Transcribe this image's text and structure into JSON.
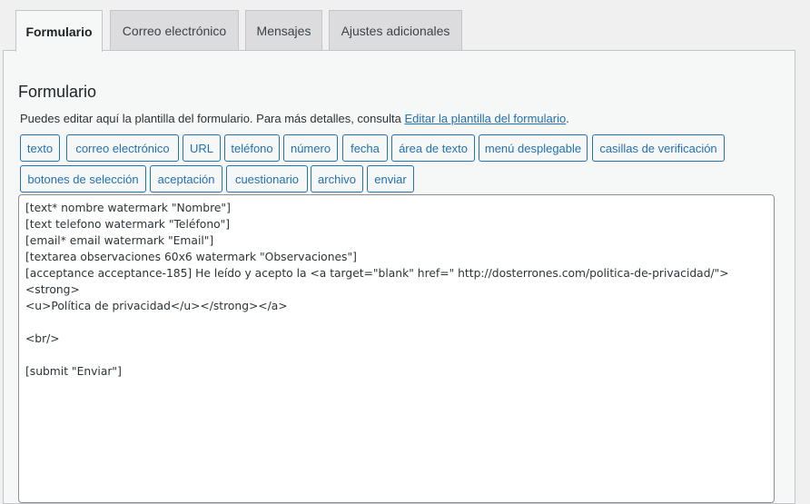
{
  "tabs": [
    {
      "label": "Formulario",
      "active": true
    },
    {
      "label": "Correo electrónico",
      "active": false
    },
    {
      "label": "Mensajes",
      "active": false
    },
    {
      "label": "Ajustes adicionales",
      "active": false
    }
  ],
  "panel": {
    "title": "Formulario",
    "description_prefix": "Puedes editar aquí la plantilla del formulario. Para más detalles, consulta ",
    "description_link": "Editar la plantilla del formulario",
    "description_suffix": "."
  },
  "tag_buttons": [
    "texto",
    "correo electrónico",
    "URL",
    "teléfono",
    "número",
    "fecha",
    "área de texto",
    "menú desplegable",
    "casillas de verificación",
    "botones de selección",
    "aceptación",
    "cuestionario",
    "archivo",
    "enviar"
  ],
  "editor": {
    "content": "[text* nombre watermark \"Nombre\"]\n[text telefono watermark \"Teléfono\"]\n[email* email watermark \"Email\"]\n[textarea observaciones 60x6 watermark \"Observaciones\"]\n[acceptance acceptance-185] He leído y acepto la <a target=\"blank\" href=\" http://dosterrones.com/politica-de-privacidad/\"><strong>\n<u>Política de privacidad</u></strong></a>\n\n<br/>\n\n[submit \"Enviar\"]"
  }
}
